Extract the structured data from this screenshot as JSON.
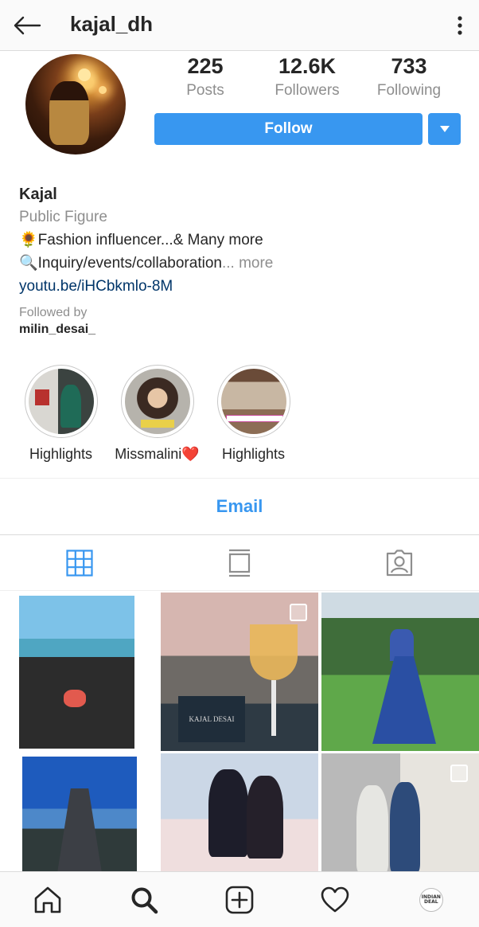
{
  "header": {
    "username": "kajal_dh",
    "back_icon": "arrow-left-icon",
    "menu_icon": "more-vertical-icon"
  },
  "profile": {
    "stats": [
      {
        "value": "225",
        "label": "Posts"
      },
      {
        "value": "12.6K",
        "label": "Followers"
      },
      {
        "value": "733",
        "label": "Following"
      }
    ],
    "follow_label": "Follow",
    "dropdown_icon": "caret-down-icon"
  },
  "bio": {
    "name": "Kajal",
    "category": "Public Figure",
    "line1": "🌻Fashion influencer...& Many more",
    "line2": "🔍Inquiry/events/collaboration",
    "line2_more": "... more",
    "link": "youtu.be/iHCbkmlo-8M",
    "followed_by_label": "Followed by",
    "followed_by_user": "milin_desai_"
  },
  "highlights": [
    {
      "label": "Highlights"
    },
    {
      "label": "Missmalini❤️"
    },
    {
      "label": "Highlights"
    }
  ],
  "contact": {
    "email_label": "Email"
  },
  "tabs": {
    "grid_icon": "grid-icon",
    "feed_icon": "feed-icon",
    "tagged_icon": "tagged-icon"
  },
  "grid": {
    "tile2_caption": "KAJAL DESAI"
  },
  "bottom_nav": {
    "items": [
      "home-icon",
      "search-icon",
      "add-icon",
      "heart-icon",
      "profile-avatar"
    ],
    "avatar_text": "INDIAN DEAL"
  },
  "colors": {
    "accent": "#3897f0",
    "text": "#262626",
    "muted": "#8e8e8e",
    "link": "#003569"
  }
}
